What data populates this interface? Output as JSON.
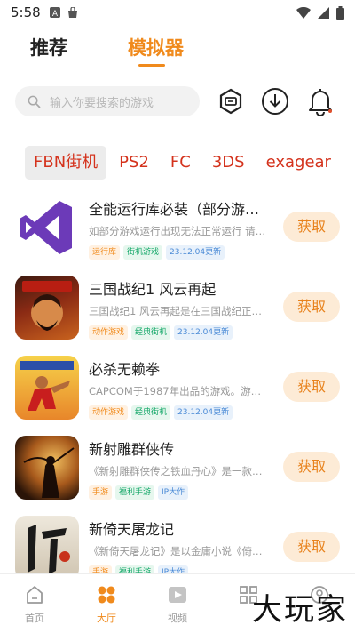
{
  "status": {
    "time": "5:58"
  },
  "top_tabs": {
    "recommend": "推荐",
    "emulator": "模拟器"
  },
  "search": {
    "placeholder": "输入你要搜索的游戏"
  },
  "categories": [
    "FBN街机",
    "PS2",
    "FC",
    "3DS",
    "exagear"
  ],
  "games": [
    {
      "title": "全能运行库必装（部分游戏...",
      "desc": "如部分游戏运行出现无法正常运行 请下...",
      "tags": [
        "运行库",
        "街机游戏",
        "23.12.04更新"
      ],
      "action": "获取"
    },
    {
      "title": "三国战纪1 风云再起",
      "desc": "三国战纪1 风云再起是在三国战纪正宗pl...",
      "tags": [
        "动作游戏",
        "经典街机",
        "23.12.04更新"
      ],
      "action": "获取"
    },
    {
      "title": "必杀无赖拳",
      "desc": "CAPCOM于1987年出品的游戏。游戏的...",
      "tags": [
        "动作游戏",
        "经典街机",
        "23.12.04更新"
      ],
      "action": "获取"
    },
    {
      "title": "新射雕群侠传",
      "desc": "《新射雕群侠传之铁血丹心》是一款集结...",
      "tags": [
        "手游",
        "福利手游",
        "IP大作"
      ],
      "action": "获取"
    },
    {
      "title": "新倚天屠龙记",
      "desc": "《新倚天屠龙记》是以金庸小说《倚天屠...",
      "tags": [
        "手游",
        "福利手游",
        "IP大作"
      ],
      "action": "获取"
    }
  ],
  "bottom_nav": {
    "home": "首页",
    "hall": "大厅",
    "video": "视频"
  },
  "watermark": "大玩家",
  "colors": {
    "accent": "#f08a1c",
    "category": "#d4321c",
    "get_bg": "#fdebd6"
  }
}
